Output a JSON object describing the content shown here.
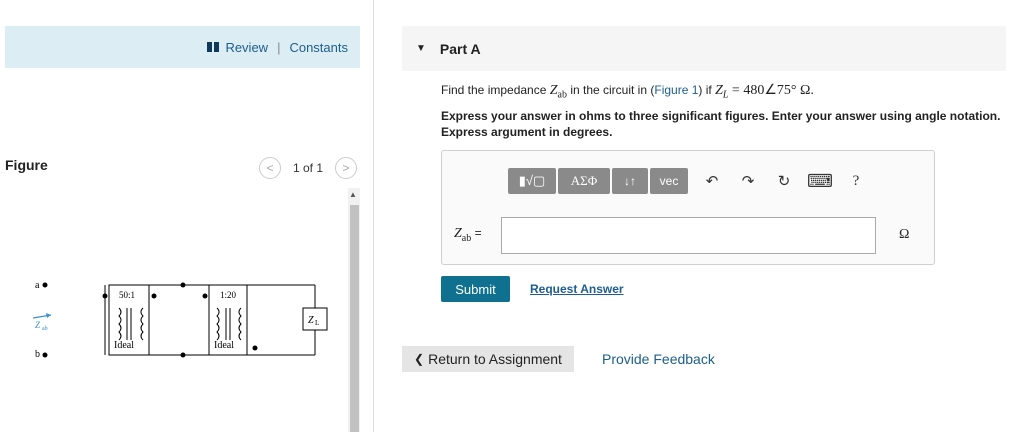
{
  "left_panel": {
    "review_label": "Review",
    "separator": "|",
    "constants_label": "Constants",
    "figure_title": "Figure",
    "pager_text": "1 of 1"
  },
  "circuit": {
    "node_a": "a",
    "node_b": "b",
    "zab_label": "Z",
    "zab_sub": "ab",
    "ratio1": "50:1",
    "ratio2": "1:20",
    "ideal1": "Ideal",
    "ideal2": "Ideal",
    "load_label": "Z",
    "load_sub": "L"
  },
  "part": {
    "caret": "▼",
    "title": "Part A"
  },
  "question": {
    "prefix": "Find the impedance ",
    "z_sym": "Z",
    "z_sub": "ab",
    "mid": " in the circuit in (",
    "figure_link": "Figure 1",
    "mid2": ") if ",
    "zl_sym": "Z",
    "zl_sub": "L",
    "value": " = 480∠75° Ω."
  },
  "instructions": "Express your answer in ohms to three significant figures. Enter your answer using angle notation. Express argument in degrees.",
  "toolbar": {
    "templates": "▮√▢",
    "greek": "ΑΣΦ",
    "arrows": "↓↑",
    "vec": "vec",
    "undo": "↶",
    "redo": "↷",
    "reset": "↻",
    "keyboard": "⌨",
    "help": "?"
  },
  "answer": {
    "label_sym": "Z",
    "label_sub": "ab",
    "equals": " =",
    "value": "",
    "unit": "Ω"
  },
  "buttons": {
    "submit": "Submit",
    "request": "Request Answer",
    "return": "Return to Assignment",
    "return_chevron": "❮",
    "feedback": "Provide Feedback"
  },
  "colors": {
    "review_bg": "#dcedf3",
    "link": "#1c5e8e",
    "submit_bg": "#0f7090"
  }
}
